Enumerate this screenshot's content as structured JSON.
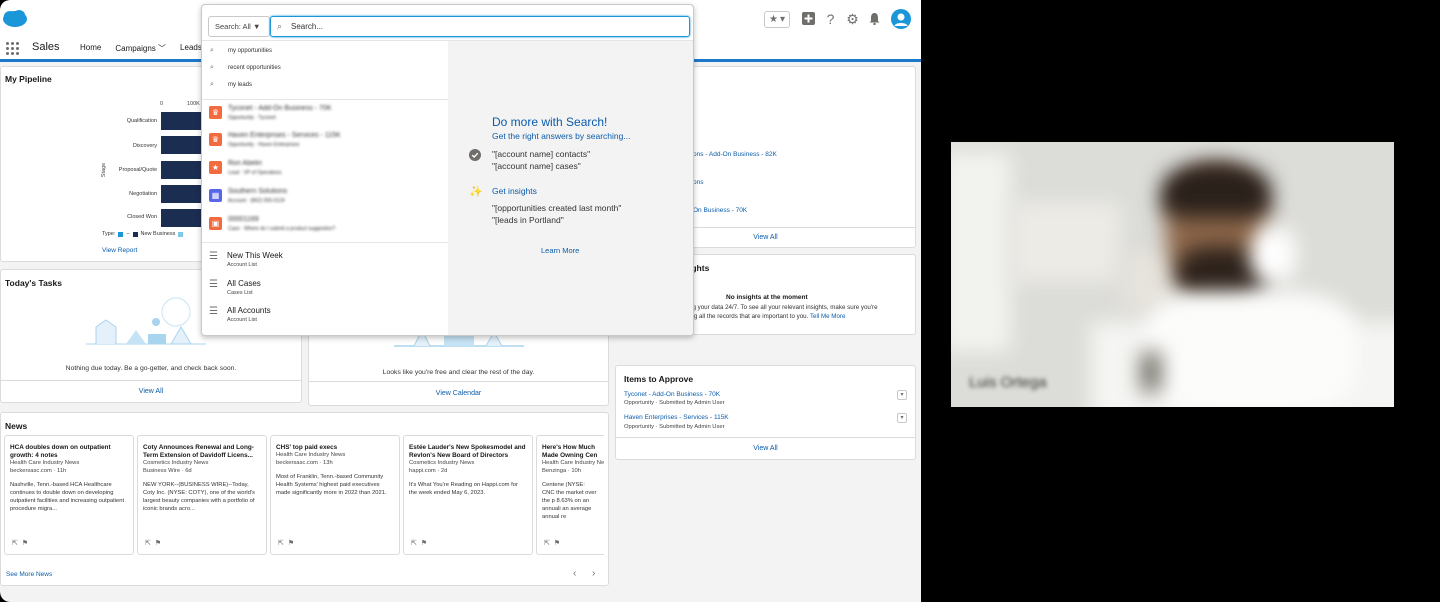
{
  "header": {
    "search_scope": "Search: All",
    "search_placeholder": "Search..."
  },
  "nav": {
    "app_name": "Sales",
    "items": [
      "Home",
      "Campaigns",
      "Leads"
    ]
  },
  "pipeline": {
    "title": "My Pipeline",
    "axis_ticks": [
      "0",
      "100K"
    ],
    "axis_title": "Stage",
    "stages": [
      "Qualification",
      "Discovery",
      "Proposal/Quote",
      "Negotiation",
      "Closed Won"
    ],
    "legend_label": "Type:",
    "legend_items": [
      "New Business"
    ],
    "view_report": "View Report"
  },
  "tasks": {
    "title": "Today's Tasks",
    "empty_text": "Nothing due today. Be a go-getter, and check back soon.",
    "view_all": "View All"
  },
  "calendar": {
    "empty_text": "Looks like you're free and clear the rest of the day.",
    "view_calendar": "View Calendar"
  },
  "recent": {
    "items": [
      "ons - Add-On Business - 82K",
      "ons",
      "On Business - 70K"
    ],
    "view_all": "View All"
  },
  "insights": {
    "title": "ights",
    "heading": "No insights at the moment",
    "body_1": "ng your data 24/7. To see all your relevant insights, make sure you're",
    "body_2": "ing all the records that are important to you.",
    "tell_me": "Tell Me More"
  },
  "approve": {
    "title": "Items to Approve",
    "items": [
      {
        "name": "Tyconet - Add-On Business - 70K",
        "type": "Opportunity",
        "sub": "Submitted by Admin User"
      },
      {
        "name": "Haven Enterprises - Services - 115K",
        "type": "Opportunity",
        "sub": "Submitted by Admin User"
      }
    ],
    "view_all": "View All"
  },
  "news": {
    "title": "News",
    "see_more": "See More News",
    "items": [
      {
        "title": "HCA doubles down on outpatient growth: 4 notes",
        "source": "Health Care Industry News",
        "meta": "beckersasc.com · 11h",
        "body": "Nashville, Tenn.-based HCA Healthcare continues to double down on developing outpatient facilities and increasing outpatient procedure migra..."
      },
      {
        "title": "Coty Announces Renewal and Long-Term Extension of Davidoff Licens...",
        "source": "Cosmetics Industry News",
        "meta": "Business Wire · 6d",
        "body": "NEW YORK--(BUSINESS WIRE)--Today, Coty Inc. (NYSE: COTY), one of the world's largest beauty companies with a portfolio of iconic brands acro..."
      },
      {
        "title": "CHS' top paid execs",
        "source": "Health Care Industry News",
        "meta": "beckersasc.com · 13h",
        "body": "Most of Franklin, Tenn.-based Community Health Systems' highest paid executives made significantly more in 2022 than 2021."
      },
      {
        "title": "Estée Lauder's New Spokesmodel and Revlon's New Board of Directors",
        "source": "Cosmetics Industry News",
        "meta": "happi.com · 2d",
        "body": "It's What You're Reading on Happi.com for the week ended May 6, 2023."
      },
      {
        "title": "Here's How Much Made Owning Cen",
        "source": "Health Care Industry News",
        "meta": "Benzinga · 10h",
        "body": "Centene (NYSE: CNC the market over the p 8.63% on an annuali an average annual re"
      }
    ]
  },
  "search_dropdown": {
    "suggestions": [
      "my opportunities",
      "recent opportunities",
      "my leads"
    ],
    "records": [
      {
        "name": "Tyconet - Add-On Business - 70K",
        "sub": "Opportunity · Tyconet",
        "color": "#f26a3f",
        "icon": "♛"
      },
      {
        "name": "Haven Enterprises - Services - 115K",
        "sub": "Opportunity · Haven Enterprises",
        "color": "#f26a3f",
        "icon": "♛"
      },
      {
        "name": "Ron Abelin",
        "sub": "Lead · VP of Operations",
        "color": "#f26a3f",
        "icon": "★"
      },
      {
        "name": "Southern Solutions",
        "sub": "Account · (862) 555-0124",
        "color": "#5867e8",
        "icon": "▦"
      },
      {
        "name": "00001169",
        "sub": "Case · Where do I submit a product suggestion?",
        "color": "#f26a3f",
        "icon": "▣"
      }
    ],
    "lists": [
      {
        "name": "New This Week",
        "sub": "Account List"
      },
      {
        "name": "All Cases",
        "sub": "Cases List"
      },
      {
        "name": "All Accounts",
        "sub": "Account List"
      }
    ],
    "promo_title": "Do more with Search!",
    "promo_head_1": "Get the right answers by searching...",
    "promo_text_1a": "\"[account name] contacts\"",
    "promo_text_1b": "\"[account name] cases\"",
    "promo_head_2": "Get insights",
    "promo_text_2a": "\"[opportunities created last month\"",
    "promo_text_2b": "\"[leads in Portland\"",
    "learn_more": "Learn More"
  },
  "video": {
    "participant_name": "Luis Ortega"
  },
  "colors": {
    "brand_blue": "#1b96d8",
    "link_blue": "#0b5cab",
    "pipeline_navy": "#1c2d52",
    "record_orange": "#f26a3f",
    "account_purple": "#5867e8"
  }
}
